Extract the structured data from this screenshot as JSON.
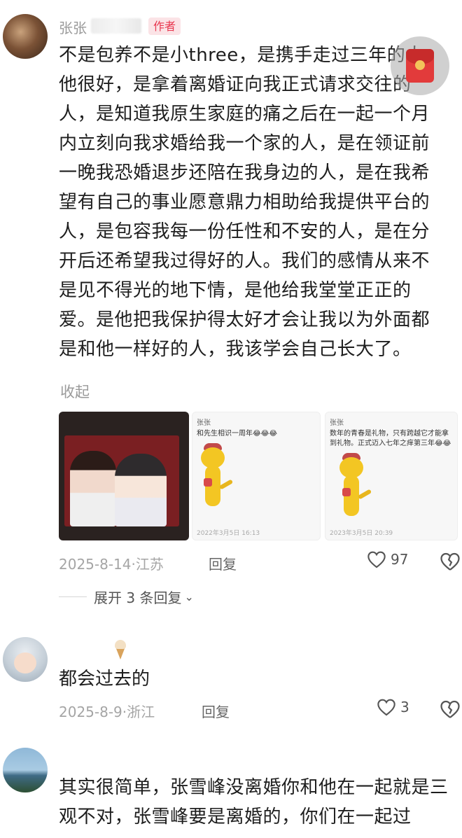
{
  "comment1": {
    "username": "张张",
    "author_badge": "作者",
    "text": "不是包养不是小three，是携手走过三年的人。他很好，是拿着离婚证向我正式请求交往的人，是知道我原生家庭的痛之后在一起一个月内立刻向我求婚给我一个家的人，是在领证前一晚我恐婚退步还陪在我身边的人，是在我希望有自己的事业愿意鼎力相助给我提供平台的人，是包容我每一份任性和不安的人，是在分开后还希望我过得好的人。我们的感情从来不是见不得光的地下情，是他给我堂堂正正的爱。是他把我保护得太好才会让我以为外面都是和他一样好的人，我该学会自己长大了。",
    "collapse": "收起",
    "images": [
      {
        "kind": "photo"
      },
      {
        "kind": "note",
        "head": "张张",
        "text": "和先生相识一周年😂😂😂",
        "foot": "2022年3月5日 16:13"
      },
      {
        "kind": "note",
        "head": "张张",
        "text": "数年的青春是礼物，只有跨越它才能拿到礼物。正式迈入七年之痒第三年😂😂",
        "foot": "2023年3月5日 20:39"
      }
    ],
    "date": "2025-8-14",
    "location": "江苏",
    "reply": "回复",
    "likes": "97",
    "expand": "展开 3 条回复"
  },
  "comment2": {
    "text": "都会过去的",
    "date": "2025-8-9",
    "location": "浙江",
    "reply": "回复",
    "likes": "3"
  },
  "comment3": {
    "text": "其实很简单，张雪峰没离婚你和他在一起就是三观不对，张雪峰要是离婚的，你们在一起过"
  },
  "colors": {
    "badge": "#e8374f",
    "meta": "#a5a5a5"
  }
}
